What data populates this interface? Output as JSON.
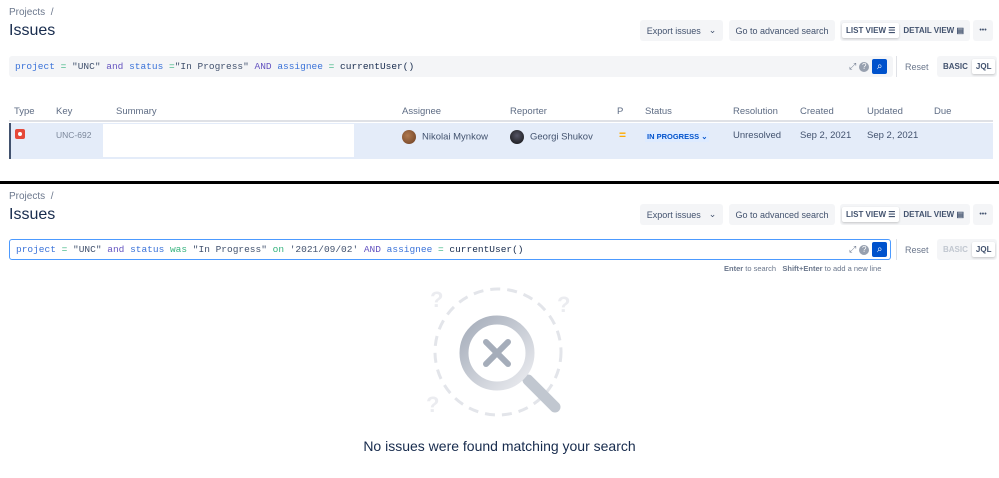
{
  "top": {
    "breadcrumb": "Projects",
    "breadcrumb_sep": "/",
    "title": "Issues",
    "export_label": "Export issues",
    "advanced_label": "Go to advanced search",
    "list_view": "LIST VIEW",
    "detail_view": "DETAIL VIEW",
    "more": "•••",
    "jql": {
      "t1": "project",
      "t2": " = ",
      "t3": "\"UNC\"",
      "t4": " and ",
      "t5": "status",
      "t6": " =",
      "t7": "\"In Progress\"",
      "t8": " AND ",
      "t9": "assignee",
      "t10": " = ",
      "t11": "currentUser()"
    },
    "reset": "Reset",
    "basic": "BASIC",
    "jql_label": "JQL",
    "columns": [
      "Type",
      "Key",
      "Summary",
      "Assignee",
      "Reporter",
      "P",
      "Status",
      "Resolution",
      "Created",
      "Updated",
      "Due"
    ],
    "row": {
      "key": "UNC-692",
      "summary": "",
      "assignee": "Nikolai Mynkow",
      "reporter": "Georgi Shukov",
      "priority": "=",
      "status": "IN PROGRESS",
      "resolution": "Unresolved",
      "created": "Sep 2, 2021",
      "updated": "Sep 2, 2021",
      "due": ""
    }
  },
  "bottom": {
    "breadcrumb": "Projects",
    "breadcrumb_sep": "/",
    "title": "Issues",
    "export_label": "Export issues",
    "advanced_label": "Go to advanced search",
    "list_view": "LIST VIEW",
    "detail_view": "DETAIL VIEW",
    "more": "•••",
    "jql": {
      "t1": "project",
      "t2": " = ",
      "t3": "\"UNC\"",
      "t4": " and ",
      "t5": "status",
      "t6": " was ",
      "t7": "\"In Progress\"",
      "t8": " on ",
      "t9": "'2021/09/02'",
      "t10": " AND ",
      "t11": "assignee",
      "t12": " = ",
      "t13": "currentUser()"
    },
    "hint_enter": "Enter",
    "hint_enter_text": " to search",
    "hint_shift": "Shift+Enter",
    "hint_shift_text": " to add a new line",
    "reset": "Reset",
    "basic": "BASIC",
    "jql_label": "JQL",
    "empty_message": "No issues were found matching your search"
  },
  "colors": {
    "accent": "#0052cc",
    "row_bg": "#e4ecf9",
    "priority": "#ffab00",
    "bug": "#e5493a"
  }
}
